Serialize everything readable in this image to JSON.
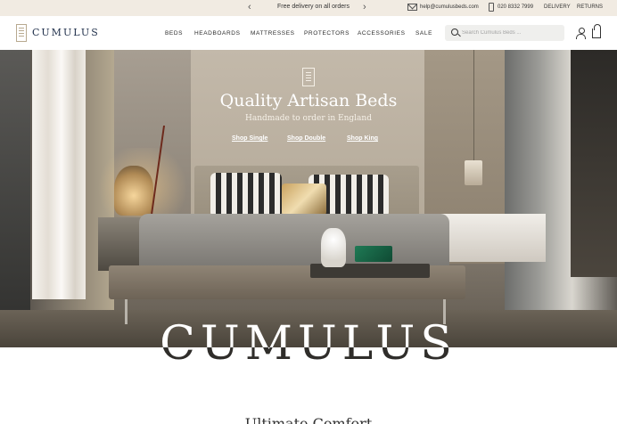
{
  "announcement": {
    "prev_glyph": "‹",
    "next_glyph": "›",
    "promo_text": "Free delivery on all orders",
    "email": "help@cumulusbeds.com",
    "phone": "020 8332 7999",
    "delivery_label": "DELIVERY",
    "returns_label": "RETURNS"
  },
  "header": {
    "logo_text": "CUMULUS",
    "nav": [
      "BEDS",
      "HEADBOARDS",
      "MATTRESSES",
      "PROTECTORS",
      "ACCESSORIES",
      "SALE"
    ],
    "search_placeholder": "Search Cumulus Beds ..."
  },
  "hero": {
    "title": "Quality Artisan Beds",
    "subtitle": "Handmade to order in England",
    "links": [
      "Shop Single",
      "Shop Double",
      "Shop King"
    ],
    "wordmark": "CUMULUS"
  },
  "next_section": {
    "heading": "Ultimate Comfort"
  },
  "colors": {
    "announcement_bg": "#f1ebe2",
    "logo_navy": "#1f2f4a",
    "search_bg": "#efefed"
  },
  "icons": {
    "email": "mail-icon",
    "phone": "phone-icon",
    "search": "search-icon",
    "account": "account-icon",
    "cart": "cart-icon"
  }
}
